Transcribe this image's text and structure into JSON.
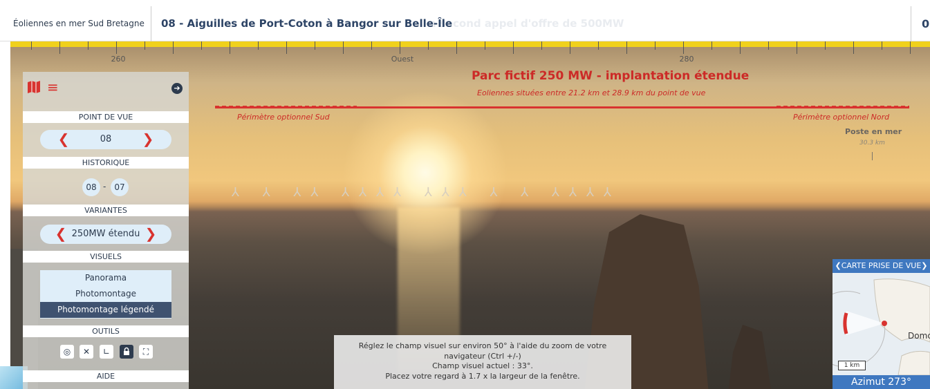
{
  "header": {
    "brand": "Éoliennes en mer Sud Bretagne",
    "title": "08 - Aiguilles de Port-Coton à Bangor sur Belle-Île",
    "title_ghost": "n second appel d'offre de 500MW",
    "right_tab": "0"
  },
  "ruler": {
    "labels": [
      "260",
      "Ouest",
      "280"
    ],
    "accent": "#f0d11c"
  },
  "overlay": {
    "parc_title": "Parc fictif 250 MW - implantation étendue",
    "parc_subtitle": "Eoliennes situées entre 21.2 km et 28.9 km du point de vue",
    "perimetre_sud": "Périmètre optionnel Sud",
    "perimetre_nord": "Périmètre optionnel Nord",
    "poste_label": "Poste en mer",
    "poste_km": "30.3 km",
    "turbines": "⅄ ⅄ ⅄⅄ ⅄⅄⅄⅄ ⅄⅄⅄ ⅄ ⅄ ⅄⅄⅄⅄",
    "accent": "#cc2a27"
  },
  "sidebar": {
    "icons": {
      "map": "map-icon",
      "menu": "menu-icon",
      "go": "arrow-right-circle-icon"
    },
    "sections": {
      "point_de_vue": "POINT DE VUE",
      "historique": "HISTORIQUE",
      "variantes": "VARIANTES",
      "visuels": "VISUELS",
      "outils": "OUTILS",
      "aide": "AIDE"
    },
    "point_de_vue_value": "08",
    "historique": [
      "08",
      "07"
    ],
    "historique_sep": "-",
    "variante_value": "250MW étendu",
    "visuels": [
      {
        "label": "Panorama",
        "active": false
      },
      {
        "label": "Photomontage",
        "active": false
      },
      {
        "label": "Photomontage légendé",
        "active": true
      }
    ],
    "tools": [
      "target-icon",
      "no-wind-icon",
      "angle-icon",
      "lock-icon",
      "fullscreen-icon"
    ],
    "tool_glyphs": [
      "◎",
      "✕",
      "∟",
      "🔒",
      "⛶"
    ]
  },
  "info": {
    "line1": "Réglez le champ visuel sur environ 50° à l'aide du zoom de votre",
    "line2": "navigateur (Ctrl +/-)",
    "line3": "Champ visuel actuel : 33°.",
    "line4": "Placez votre regard à 1.7 x la largeur de la fenêtre."
  },
  "minimap": {
    "header": "CARTE PRISE DE VUE",
    "scale": "1 km",
    "place": "Domc",
    "azimut": "Azimut 273°",
    "accent": "#3f78c0"
  }
}
